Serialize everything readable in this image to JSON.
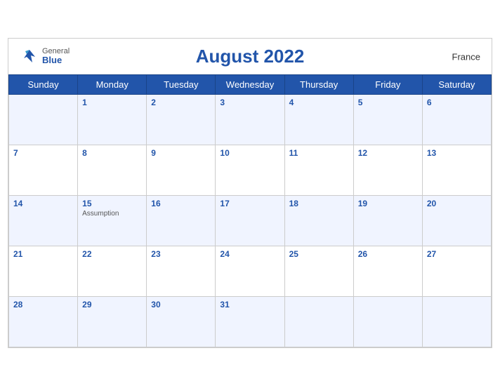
{
  "header": {
    "title": "August 2022",
    "country": "France",
    "logo": {
      "general": "General",
      "blue": "Blue"
    }
  },
  "weekdays": [
    "Sunday",
    "Monday",
    "Tuesday",
    "Wednesday",
    "Thursday",
    "Friday",
    "Saturday"
  ],
  "weeks": [
    [
      {
        "day": "",
        "events": []
      },
      {
        "day": "1",
        "events": []
      },
      {
        "day": "2",
        "events": []
      },
      {
        "day": "3",
        "events": []
      },
      {
        "day": "4",
        "events": []
      },
      {
        "day": "5",
        "events": []
      },
      {
        "day": "6",
        "events": []
      }
    ],
    [
      {
        "day": "7",
        "events": []
      },
      {
        "day": "8",
        "events": []
      },
      {
        "day": "9",
        "events": []
      },
      {
        "day": "10",
        "events": []
      },
      {
        "day": "11",
        "events": []
      },
      {
        "day": "12",
        "events": []
      },
      {
        "day": "13",
        "events": []
      }
    ],
    [
      {
        "day": "14",
        "events": []
      },
      {
        "day": "15",
        "events": [
          "Assumption"
        ]
      },
      {
        "day": "16",
        "events": []
      },
      {
        "day": "17",
        "events": []
      },
      {
        "day": "18",
        "events": []
      },
      {
        "day": "19",
        "events": []
      },
      {
        "day": "20",
        "events": []
      }
    ],
    [
      {
        "day": "21",
        "events": []
      },
      {
        "day": "22",
        "events": []
      },
      {
        "day": "23",
        "events": []
      },
      {
        "day": "24",
        "events": []
      },
      {
        "day": "25",
        "events": []
      },
      {
        "day": "26",
        "events": []
      },
      {
        "day": "27",
        "events": []
      }
    ],
    [
      {
        "day": "28",
        "events": []
      },
      {
        "day": "29",
        "events": []
      },
      {
        "day": "30",
        "events": []
      },
      {
        "day": "31",
        "events": []
      },
      {
        "day": "",
        "events": []
      },
      {
        "day": "",
        "events": []
      },
      {
        "day": "",
        "events": []
      }
    ]
  ]
}
